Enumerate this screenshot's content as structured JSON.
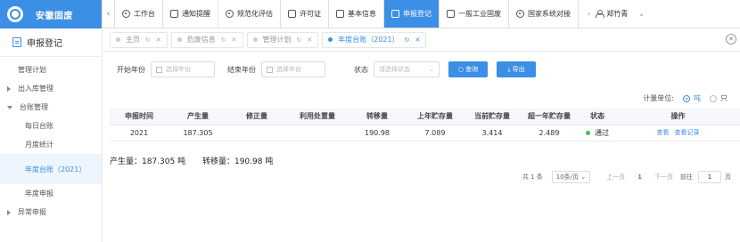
{
  "brand": {
    "name": "安徽固废"
  },
  "sidebar": {
    "title": "申报登记",
    "items": [
      {
        "label": "管理计划"
      },
      {
        "label": "出入库管理"
      },
      {
        "label": "台账管理"
      },
      {
        "label": "每日台账"
      },
      {
        "label": "月度统计"
      },
      {
        "label": "年度台账（2021）"
      },
      {
        "label": "年度申报"
      },
      {
        "label": "异常申报"
      }
    ]
  },
  "topnav": {
    "items": [
      {
        "label": "工作台"
      },
      {
        "label": "通知提醒"
      },
      {
        "label": "规范化评估"
      },
      {
        "label": "许可证"
      },
      {
        "label": "基本信息"
      },
      {
        "label": "申报登记"
      },
      {
        "label": "一般工业固废"
      },
      {
        "label": "国家系统对接"
      }
    ],
    "user": "郑竹青"
  },
  "tabs": [
    {
      "label": "主页"
    },
    {
      "label": "危废信息"
    },
    {
      "label": "管理计划"
    },
    {
      "label": "年度台账（2021）"
    }
  ],
  "filters": {
    "start_label": "开始年份",
    "start_placeholder": "选择年份",
    "end_label": "结束年份",
    "end_placeholder": "选择年份",
    "status_label": "状态",
    "status_placeholder": "请选择状态",
    "query_button": "查询",
    "export_button": "导出"
  },
  "unit": {
    "label": "计量单位:",
    "opt1": "吨",
    "opt2": "只"
  },
  "table": {
    "headers": [
      "申报时间",
      "产生量",
      "修正量",
      "利用处置量",
      "转移量",
      "上年贮存量",
      "当前贮存量",
      "超一年贮存量",
      "状态",
      "操作"
    ],
    "rows": [
      {
        "year": "2021",
        "produced": "187.305",
        "corrected": "",
        "disposed": "",
        "transferred": "190.98",
        "last_storage": "7.089",
        "current_storage": "3.414",
        "over_year": "2.489",
        "status": "通过",
        "op1": "查看",
        "op2": "查看记录"
      }
    ]
  },
  "summary": {
    "produced": "产生量：187.305 吨",
    "transferred": "转移量：190.98 吨"
  },
  "pager": {
    "total": "共 1 条",
    "size": "10条/页",
    "prev": "上一页",
    "page": "1",
    "next": "下一页",
    "goto": "前往",
    "goto_value": "1",
    "unit": "页"
  }
}
